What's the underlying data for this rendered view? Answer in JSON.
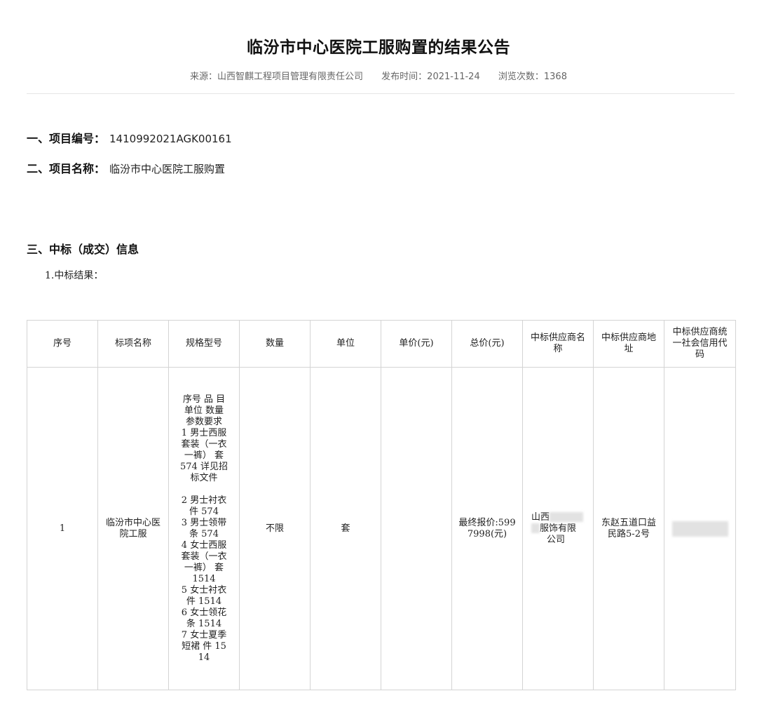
{
  "title": "临汾市中心医院工服购置的结果公告",
  "meta": {
    "source": "来源：山西智麒工程项目管理有限责任公司",
    "publish_time": "发布时间：2021-11-24",
    "views": "浏览次数：1368"
  },
  "section1": {
    "label": "一、项目编号：",
    "value": "1410992021AGK00161"
  },
  "section2": {
    "label": "二、项目名称：",
    "value": "临汾市中心医院工服购置"
  },
  "section3": {
    "label": "三、中标（成交）信息"
  },
  "result_heading": "1.中标结果：",
  "table": {
    "headers": [
      "序号",
      "标项名称",
      "规格型号",
      "数量",
      "单位",
      "单价(元)",
      "总价(元)",
      "中标供应商名称",
      "中标供应商地址",
      "中标供应商统一社会信用代码"
    ],
    "row": {
      "seq": "1",
      "item_name": "临汾市中心医院工服",
      "spec": "序号 品 目\n单位 数量\n参数要求\n1 男士西服\n套装（一衣\n一裤） 套\n574 详见招\n标文件\n\n2 男士衬衣\n件 574\n3 男士领带\n条 574\n4 女士西服\n套装（一衣\n一裤） 套\n1514\n5 女士衬衣\n件 1514\n6 女士领花\n条 1514\n7 女士夏季\n短裙 件 15\n14",
      "quantity": "不限",
      "unit": "套",
      "unit_price": "",
      "total_price": "最终报价:5997998(元)",
      "supplier_name_start": "山西",
      "supplier_name_mid": "服饰有限",
      "supplier_name_end": "公司",
      "supplier_address": "东赵五道口益民路5-2号",
      "credit_code": ""
    }
  }
}
